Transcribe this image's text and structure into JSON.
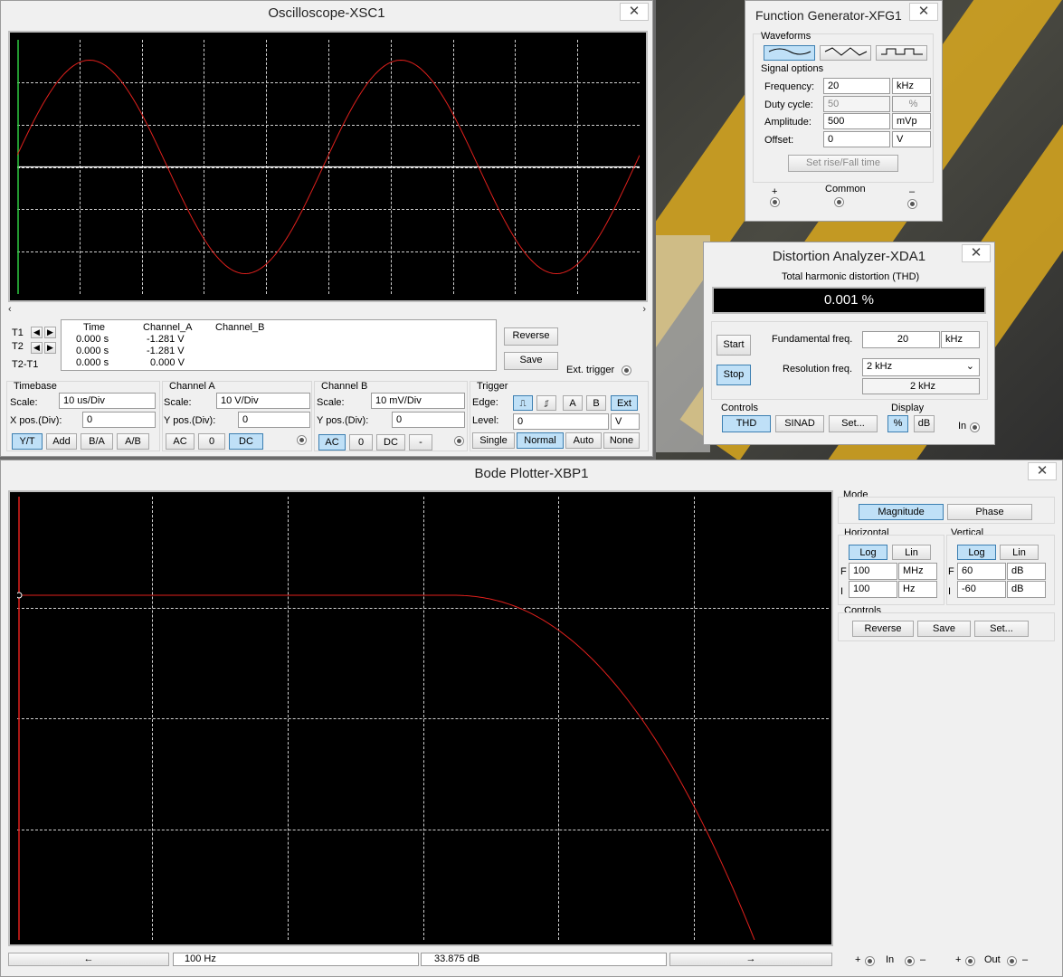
{
  "oscilloscope": {
    "title": "Oscilloscope-XSC1",
    "close": "✕",
    "readout": {
      "headers": [
        "Time",
        "Channel_A",
        "Channel_B"
      ],
      "rows": [
        {
          "label": "T1",
          "time": "0.000 s",
          "a": "-1.281 V",
          "b": ""
        },
        {
          "label": "T2",
          "time": "0.000 s",
          "a": "-1.281 V",
          "b": ""
        },
        {
          "label": "T2-T1",
          "time": "0.000 s",
          "a": "0.000 V",
          "b": ""
        }
      ]
    },
    "reverse": "Reverse",
    "save": "Save",
    "ext_trigger": "Ext. trigger",
    "timebase": {
      "title": "Timebase",
      "scale_label": "Scale:",
      "scale": "10 us/Div",
      "xpos_label": "X pos.(Div):",
      "xpos": "0",
      "buttons": [
        "Y/T",
        "Add",
        "B/A",
        "A/B"
      ]
    },
    "channel_a": {
      "title": "Channel A",
      "scale_label": "Scale:",
      "scale": "10  V/Div",
      "ypos_label": "Y pos.(Div):",
      "ypos": "0",
      "buttons": [
        "AC",
        "0",
        "DC"
      ]
    },
    "channel_b": {
      "title": "Channel B",
      "scale_label": "Scale:",
      "scale": "10 mV/Div",
      "ypos_label": "Y pos.(Div):",
      "ypos": "0",
      "buttons": [
        "AC",
        "0",
        "DC",
        "-"
      ]
    },
    "trigger": {
      "title": "Trigger",
      "edge_label": "Edge:",
      "level_label": "Level:",
      "level": "0",
      "level_unit": "V",
      "edge_buttons": [
        "A",
        "B",
        "Ext"
      ],
      "mode_buttons": [
        "Single",
        "Normal",
        "Auto",
        "None"
      ]
    },
    "colors": {
      "trace": "#e0201c",
      "cursor_t1": "#2ecc40",
      "grid": "#cfcfcf"
    }
  },
  "function_generator": {
    "title": "Function Generator-XFG1",
    "close": "✕",
    "waveforms_label": "Waveforms",
    "signal_options_label": "Signal options",
    "rows": [
      {
        "label": "Frequency:",
        "value": "20",
        "unit": "kHz"
      },
      {
        "label": "Duty cycle:",
        "value": "50",
        "unit": "%"
      },
      {
        "label": "Amplitude:",
        "value": "500",
        "unit": "mVp"
      },
      {
        "label": "Offset:",
        "value": "0",
        "unit": "V"
      }
    ],
    "rise_fall": "Set rise/Fall time",
    "plus": "+",
    "common": "Common",
    "minus": "–"
  },
  "distortion_analyzer": {
    "title": "Distortion Analyzer-XDA1",
    "close": "✕",
    "thd_label": "Total harmonic distortion (THD)",
    "thd_value": "0.001 %",
    "start": "Start",
    "stop": "Stop",
    "fund_label": "Fundamental freq.",
    "fund_value": "20",
    "fund_unit": "kHz",
    "res_label": "Resolution freq.",
    "res_value": "2 kHz",
    "res_display": "2 kHz",
    "controls_label": "Controls",
    "controls": [
      "THD",
      "SINAD",
      "Set..."
    ],
    "display_label": "Display",
    "display": [
      "%",
      "dB"
    ],
    "in_label": "In"
  },
  "bode_plotter": {
    "title": "Bode Plotter-XBP1",
    "close": "✕",
    "mode_label": "Mode",
    "magnitude": "Magnitude",
    "phase": "Phase",
    "horizontal_label": "Horizontal",
    "vertical_label": "Vertical",
    "log": "Log",
    "lin": "Lin",
    "h_f_label": "F",
    "h_f": "100",
    "h_f_unit": "MHz",
    "h_i_label": "I",
    "h_i": "100",
    "h_i_unit": "Hz",
    "v_f_label": "F",
    "v_f": "60",
    "v_f_unit": "dB",
    "v_i_label": "I",
    "v_i": "-60",
    "v_i_unit": "dB",
    "controls_label": "Controls",
    "reverse": "Reverse",
    "save": "Save",
    "set": "Set...",
    "left_arrow": "🡐",
    "right_arrow": "🡒",
    "freq_readout": "100  Hz",
    "db_readout": "33.875 dB",
    "in_label": "In",
    "out_label": "Out",
    "plus": "+",
    "minus": "–"
  }
}
